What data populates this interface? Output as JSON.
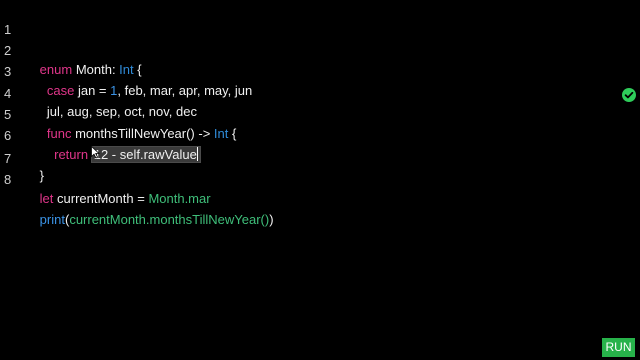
{
  "editor": {
    "lines": [
      {
        "number": "1",
        "tokens": [
          "enum",
          " Month: ",
          "Int",
          " {"
        ]
      },
      {
        "number": "2",
        "tokens": [
          "  case",
          " jan = ",
          "1",
          ", feb, mar, apr, may, jun"
        ]
      },
      {
        "number": "3",
        "tokens": [
          "  jul, aug, sep, oct, nov, dec"
        ]
      },
      {
        "number": "4",
        "tokens": [
          "  func",
          " monthsTillNewYear() -> ",
          "Int",
          " {"
        ]
      },
      {
        "number": "5",
        "tokens": [
          "    return",
          " ",
          "12 - self.rawValue"
        ]
      },
      {
        "number": "6",
        "tokens": [
          "}"
        ]
      },
      {
        "number": "7",
        "tokens": [
          "let",
          " currentMonth = ",
          "Month.mar"
        ]
      },
      {
        "number": "8",
        "tokens": [
          "print",
          "(",
          "currentMonth.monthsTillNewYear()",
          ")"
        ]
      }
    ]
  },
  "status": {
    "icon": "check-circle-icon",
    "color": "#2ecc5a"
  },
  "run_button": {
    "label": "RUN",
    "color": "#27b24a"
  },
  "colors": {
    "keyword": "#e0368a",
    "type": "#2f8bd8",
    "number": "#3b93e6",
    "identifier_green": "#3fbf7a",
    "background": "#000000"
  }
}
